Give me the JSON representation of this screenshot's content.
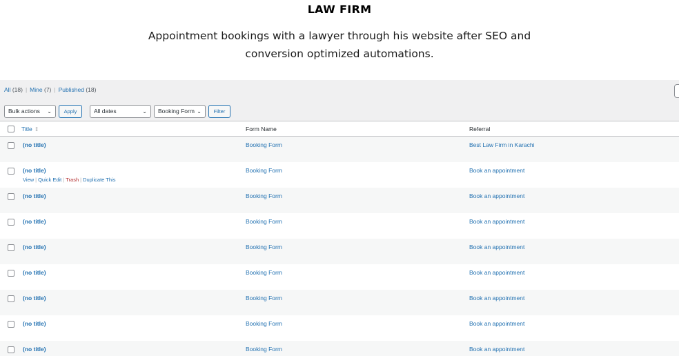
{
  "hero": {
    "title": "LAW FIRM",
    "subtitle_line1": "Appointment bookings with a lawyer through his website after SEO and",
    "subtitle_line2": "conversion optimized automations."
  },
  "views": {
    "all_label": "All",
    "all_count": "(18)",
    "mine_label": "Mine",
    "mine_count": "(7)",
    "published_label": "Published",
    "published_count": "(18)"
  },
  "tablenav": {
    "bulk_actions": "Bulk actions",
    "apply": "Apply",
    "dates": "All dates",
    "form_filter": "Booking Form",
    "filter": "Filter"
  },
  "columns": {
    "title": "Title",
    "form_name": "Form Name",
    "referral": "Referral"
  },
  "rows": [
    {
      "title": "(no title)",
      "form": "Booking Form",
      "referral": "Best Law Firm in Karachi"
    },
    {
      "title": "(no title)",
      "form": "Booking Form",
      "referral": "Book an appointment",
      "actions": {
        "view": "View",
        "quick_edit": "Quick Edit",
        "trash": "Trash",
        "duplicate": "Duplicate This"
      }
    },
    {
      "title": "(no title)",
      "form": "Booking Form",
      "referral": "Book an appointment"
    },
    {
      "title": "(no title)",
      "form": "Booking Form",
      "referral": "Book an appointment"
    },
    {
      "title": "(no title)",
      "form": "Booking Form",
      "referral": "Book an appointment"
    },
    {
      "title": "(no title)",
      "form": "Booking Form",
      "referral": "Book an appointment"
    },
    {
      "title": "(no title)",
      "form": "Booking Form",
      "referral": "Book an appointment"
    },
    {
      "title": "(no title)",
      "form": "Booking Form",
      "referral": "Book an appointment"
    },
    {
      "title": "(no title)",
      "form": "Booking Form",
      "referral": "Book an appointment"
    }
  ],
  "colors": {
    "link": "#2271b1",
    "trash": "#b32d2e",
    "admin_bg": "#f0f0f1",
    "alt_row": "#f6f7f7"
  },
  "icons": [
    "chevron-down-icon",
    "sort-arrows-icon",
    "checkbox-icon"
  ]
}
